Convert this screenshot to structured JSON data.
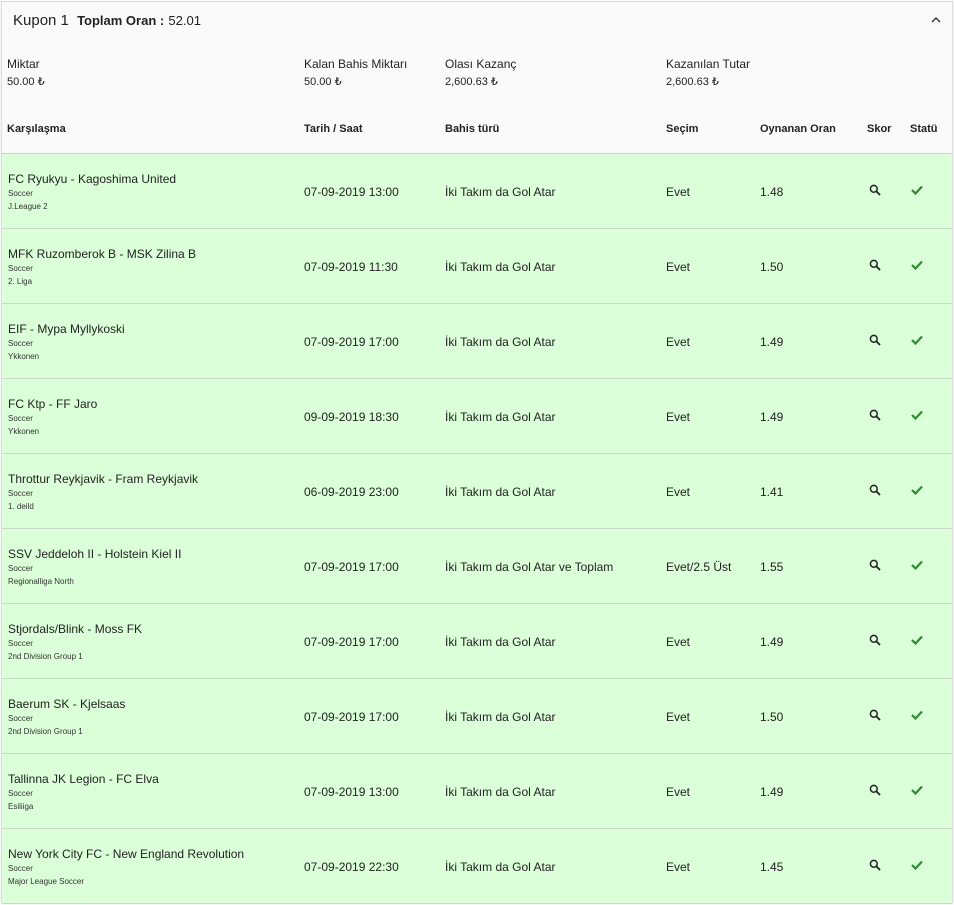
{
  "coupon": {
    "title": "Kupon 1",
    "total_odds_label": "Toplam Oran :",
    "total_odds_value": "52.01"
  },
  "summary": {
    "stake_label": "Miktar",
    "stake_value": "50.00 ₺",
    "remaining_label": "Kalan Bahis Miktarı",
    "remaining_value": "50.00 ₺",
    "potential_label": "Olası Kazanç",
    "potential_value": "2,600.63 ₺",
    "won_label": "Kazanılan Tutar",
    "won_value": "2,600.63 ₺"
  },
  "table": {
    "headers": {
      "match": "Karşılaşma",
      "datetime": "Tarih / Saat",
      "bet_type": "Bahis türü",
      "selection": "Seçim",
      "odds": "Oynanan Oran",
      "score": "Skor",
      "status": "Statü"
    },
    "rows": [
      {
        "match": "FC Ryukyu - Kagoshima United",
        "sport": "Soccer",
        "league": "J.League 2",
        "datetime": "07-09-2019 13:00",
        "bet_type": "İki Takım da Gol Atar",
        "selection": "Evet",
        "odds": "1.48"
      },
      {
        "match": "MFK Ruzomberok B - MSK Zilina B",
        "sport": "Soccer",
        "league": "2. Liga",
        "datetime": "07-09-2019 11:30",
        "bet_type": "İki Takım da Gol Atar",
        "selection": "Evet",
        "odds": "1.50"
      },
      {
        "match": "EIF - Mypa Myllykoski",
        "sport": "Soccer",
        "league": "Ykkonen",
        "datetime": "07-09-2019 17:00",
        "bet_type": "İki Takım da Gol Atar",
        "selection": "Evet",
        "odds": "1.49"
      },
      {
        "match": "FC Ktp - FF Jaro",
        "sport": "Soccer",
        "league": "Ykkonen",
        "datetime": "09-09-2019 18:30",
        "bet_type": "İki Takım da Gol Atar",
        "selection": "Evet",
        "odds": "1.49"
      },
      {
        "match": "Throttur Reykjavik - Fram Reykjavik",
        "sport": "Soccer",
        "league": "1. deild",
        "datetime": "06-09-2019 23:00",
        "bet_type": "İki Takım da Gol Atar",
        "selection": "Evet",
        "odds": "1.41"
      },
      {
        "match": "SSV Jeddeloh II - Holstein Kiel II",
        "sport": "Soccer",
        "league": "Regionalliga North",
        "datetime": "07-09-2019 17:00",
        "bet_type": "İki Takım da Gol Atar ve Toplam",
        "selection": "Evet/2.5 Üst",
        "odds": "1.55"
      },
      {
        "match": "Stjordals/Blink - Moss FK",
        "sport": "Soccer",
        "league": "2nd Division Group 1",
        "datetime": "07-09-2019 17:00",
        "bet_type": "İki Takım da Gol Atar",
        "selection": "Evet",
        "odds": "1.49"
      },
      {
        "match": "Baerum SK - Kjelsaas",
        "sport": "Soccer",
        "league": "2nd Division Group 1",
        "datetime": "07-09-2019 17:00",
        "bet_type": "İki Takım da Gol Atar",
        "selection": "Evet",
        "odds": "1.50"
      },
      {
        "match": "Tallinna JK Legion - FC Elva",
        "sport": "Soccer",
        "league": "Esiliiga",
        "datetime": "07-09-2019 13:00",
        "bet_type": "İki Takım da Gol Atar",
        "selection": "Evet",
        "odds": "1.49"
      },
      {
        "match": "New York City FC - New England Revolution",
        "sport": "Soccer",
        "league": "Major League Soccer",
        "datetime": "07-09-2019 22:30",
        "bet_type": "İki Takım da Gol Atar",
        "selection": "Evet",
        "odds": "1.45"
      }
    ]
  },
  "icons": {
    "collapse": "chevron-up-icon",
    "score": "search-icon",
    "status": "checkmark-icon"
  },
  "colors": {
    "won_row_background": "#dbffd8",
    "status_check": "#2e8b2e"
  }
}
